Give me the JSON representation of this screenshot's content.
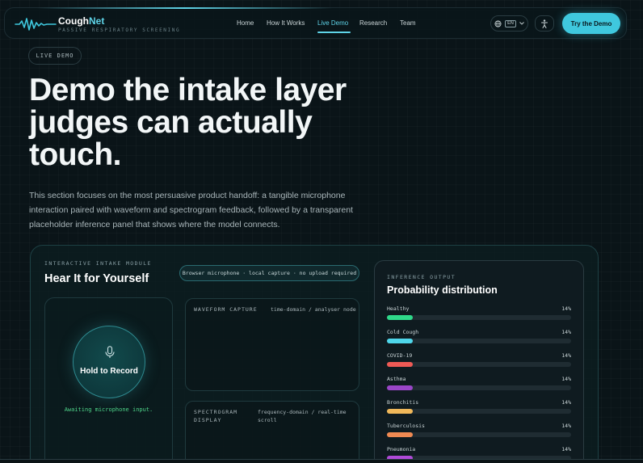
{
  "nav": {
    "brand_main": "Cough",
    "brand_accent": "Net",
    "tagline": "PASSIVE RESPIRATORY SCREENING",
    "links": [
      "Home",
      "How It Works",
      "Live Demo",
      "Research",
      "Team"
    ],
    "active_link": "Live Demo",
    "lang": "EN",
    "cta": "Try the Demo",
    "icons": [
      "waveform-logo-icon",
      "globe-icon",
      "chevron-down-icon",
      "accessibility-icon"
    ]
  },
  "hero": {
    "pill": "LIVE DEMO",
    "title": "Demo the intake layer judges can actually touch.",
    "description": "This section focuses on the most persuasive product handoff: a tangible microphone interaction paired with waveform and spectrogram feedback, followed by a transparent placeholder inference panel that shows where the model connects."
  },
  "demo": {
    "module_label": "INTERACTIVE INTAKE MODULE",
    "module_title": "Hear It for Yourself",
    "mic_badge": "Browser microphone · local capture · no upload required",
    "record_label": "Hold to Record",
    "status": "Awaiting microphone input.",
    "waveform_title": "WAVEFORM CAPTURE",
    "waveform_note": "time-domain / analyser node",
    "spectrogram_title": "SPECTROGRAM DISPLAY",
    "spectrogram_note": "frequency-domain / real-time scroll"
  },
  "inference": {
    "label": "INFERENCE OUTPUT",
    "title": "Probability distribution",
    "rows": [
      {
        "name": "Healthy",
        "value": "14%",
        "fraction": 0.14,
        "color": "#2fd98a"
      },
      {
        "name": "Cold Cough",
        "value": "14%",
        "fraction": 0.14,
        "color": "#4fd6ea"
      },
      {
        "name": "COVID-19",
        "value": "14%",
        "fraction": 0.14,
        "color": "#ef5a55"
      },
      {
        "name": "Asthma",
        "value": "14%",
        "fraction": 0.14,
        "color": "#9a46c8"
      },
      {
        "name": "Bronchitis",
        "value": "14%",
        "fraction": 0.14,
        "color": "#f0b85a"
      },
      {
        "name": "Tuberculosis",
        "value": "14%",
        "fraction": 0.14,
        "color": "#f08a52"
      },
      {
        "name": "Pneumonia",
        "value": "14%",
        "fraction": 0.14,
        "color": "#b04ad8"
      }
    ]
  }
}
